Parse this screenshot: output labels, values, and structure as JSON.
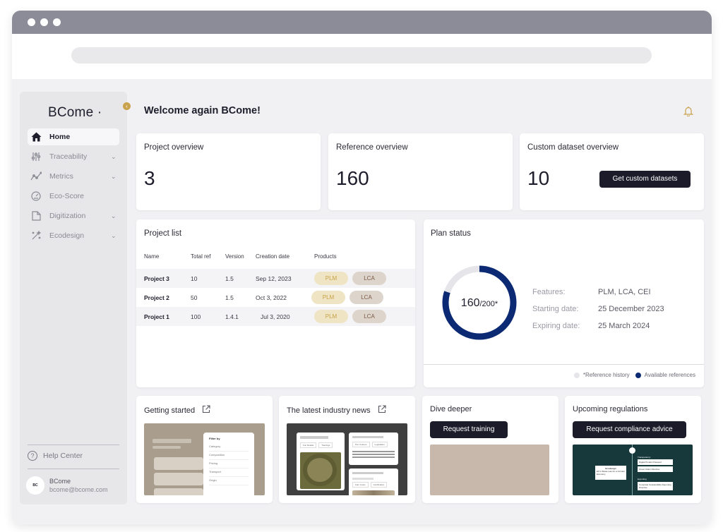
{
  "sidebar": {
    "logo": "BCome",
    "items": [
      {
        "label": "Home",
        "icon": "home-icon",
        "active": true,
        "expandable": false
      },
      {
        "label": "Traceability",
        "icon": "sliders-icon",
        "active": false,
        "expandable": true
      },
      {
        "label": "Metrics",
        "icon": "line-chart-icon",
        "active": false,
        "expandable": true
      },
      {
        "label": "Eco-Score",
        "icon": "gauge-icon",
        "active": false,
        "expandable": false
      },
      {
        "label": "Digitization",
        "icon": "document-icon",
        "active": false,
        "expandable": true
      },
      {
        "label": "Ecodesign",
        "icon": "magic-wand-icon",
        "active": false,
        "expandable": true
      }
    ],
    "help_label": "Help Center",
    "user": {
      "avatar": "BC",
      "name": "BCome",
      "email": "bcome@bcome.com"
    }
  },
  "header": {
    "welcome": "Welcome again BCome!"
  },
  "overview": {
    "project": {
      "title": "Project overview",
      "value": "3"
    },
    "reference": {
      "title": "Reference overview",
      "value": "160"
    },
    "custom": {
      "title": "Custom dataset overview",
      "value": "10",
      "button": "Get custom datasets"
    }
  },
  "project_list": {
    "title": "Project list",
    "columns": [
      "Name",
      "Total ref",
      "Version",
      "Creation date",
      "Products"
    ],
    "rows": [
      {
        "name": "Project 3",
        "total_ref": "10",
        "version": "1.5",
        "date": "Sep 12, 2023",
        "products": [
          "PLM",
          "LCA"
        ]
      },
      {
        "name": "Project 2",
        "total_ref": "50",
        "version": "1.5",
        "date": "Oct 3, 2022",
        "products": [
          "PLM",
          "LCA"
        ]
      },
      {
        "name": "Project 1",
        "total_ref": "100",
        "version": "1.4.1",
        "date": "Jul 3, 2020",
        "products": [
          "PLM",
          "LCA"
        ]
      }
    ]
  },
  "plan_status": {
    "title": "Plan status",
    "used": "160",
    "total": "/200*",
    "used_fraction": 0.8,
    "info": [
      {
        "label": "Features:",
        "value": "PLM, LCA, CEI"
      },
      {
        "label": "Starting date:",
        "value": "25 December 2023"
      },
      {
        "label": "Expiring date:",
        "value": "25 March 2024"
      }
    ],
    "legend": [
      {
        "label": "*Reference history",
        "color": "#e6e6ea"
      },
      {
        "label": "Available references",
        "color": "#0b2a73"
      }
    ]
  },
  "bottom": {
    "getting_started": {
      "title": "Getting started",
      "filter_title": "Filter by",
      "filter_items": [
        "Category",
        "Composition",
        "Pricing",
        "Transport",
        "Origin"
      ]
    },
    "news": {
      "title": "The latest industry news",
      "tags": [
        "Fun Details",
        "Trainings",
        "Pon Colours",
        "Legislation",
        "Fam Costs",
        "Certification"
      ]
    },
    "dive": {
      "title": "Dive deeper",
      "button": "Request training"
    },
    "regulations": {
      "title": "Upcoming regulations",
      "button": "Request compliance advice",
      "diagram": {
        "transparency_label": "Transparency",
        "transparency_items": [
          "Digital Product Passport",
          "Green Claim Directive"
        ],
        "ecodesign_label": "Ecodesign",
        "ecodesign_items": [
          "EU's Waste Law for a Circular Economy"
        ],
        "exporting_label": "Exporting",
        "exporting_items": [
          "Corporate Sustainability Reporting Directive"
        ]
      }
    }
  },
  "colors": {
    "accent_dark": "#1b1b2a",
    "ring": "#0b2a73",
    "plm": "#c7a348",
    "lca": "#7a5a45",
    "collapse": "#c9a24e"
  }
}
